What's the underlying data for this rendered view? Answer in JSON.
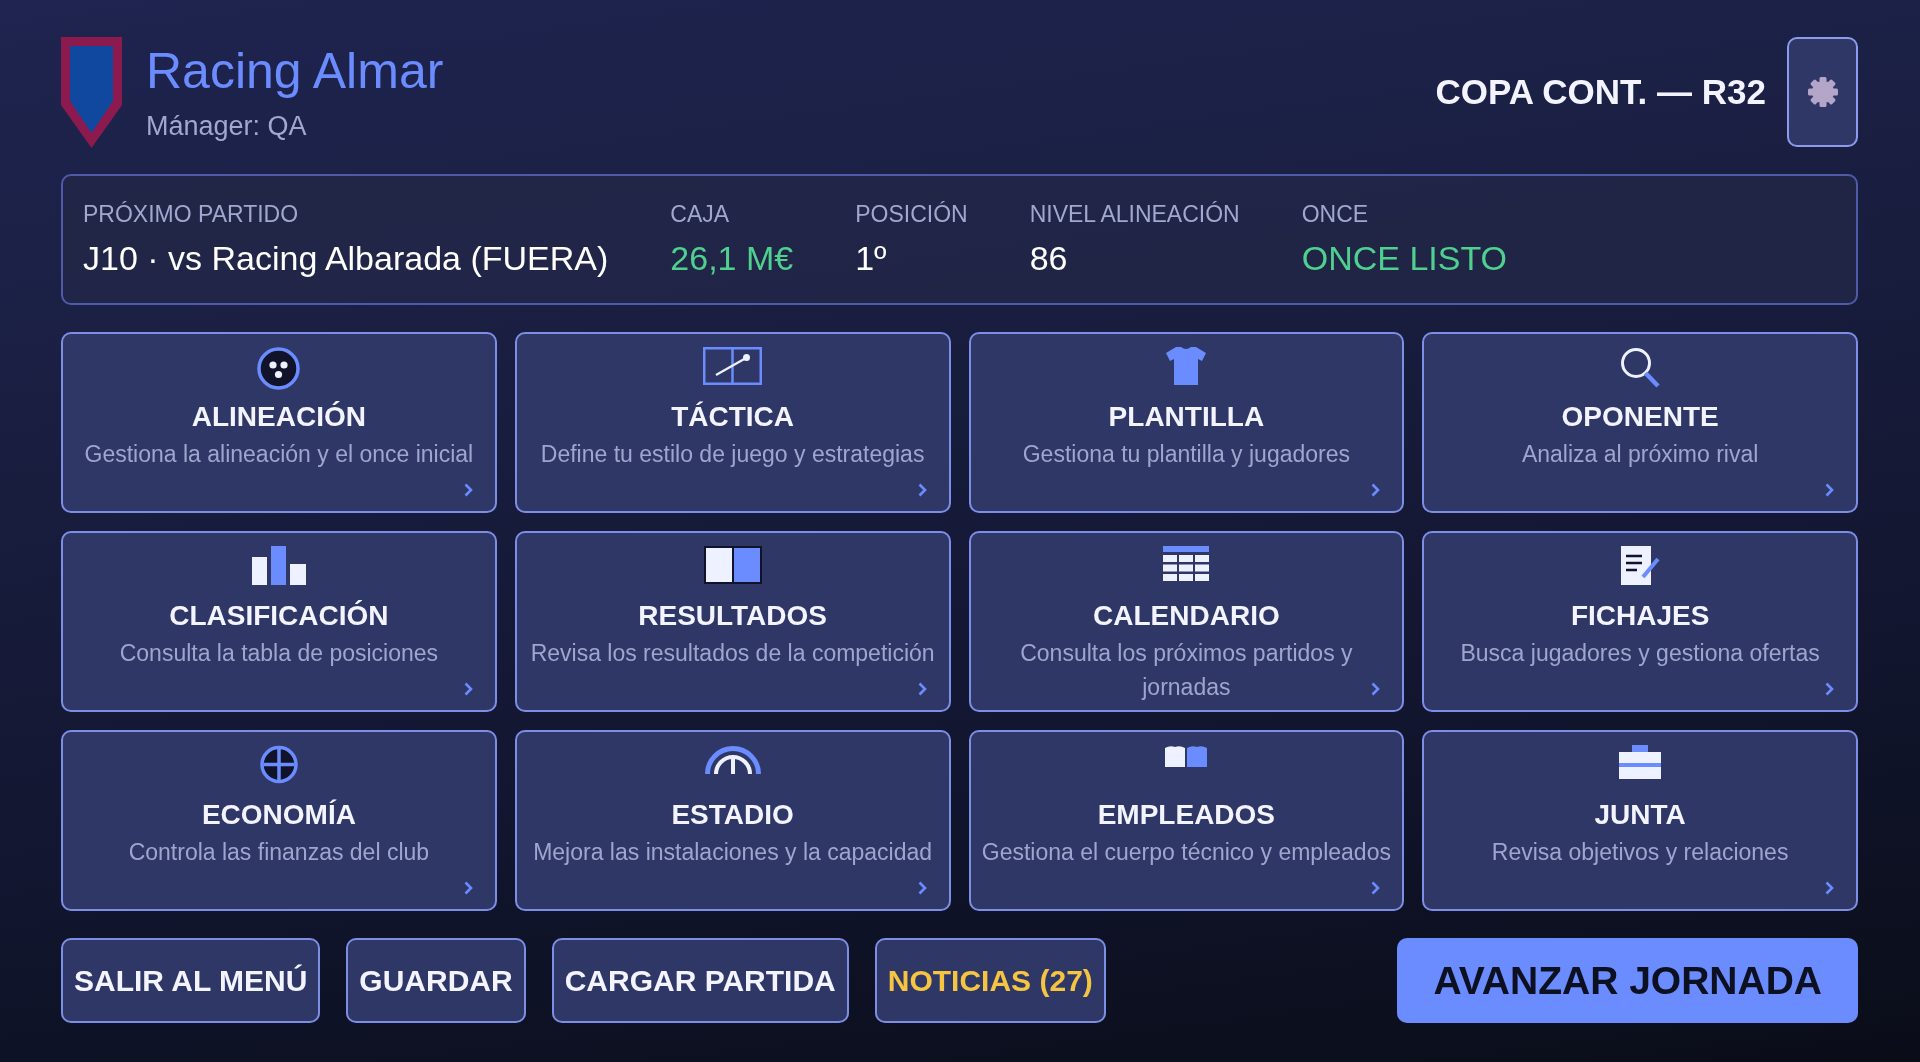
{
  "header": {
    "club_name": "Racing Almar",
    "manager": "Mánager: QA",
    "competition": "COPA CONT. — R32"
  },
  "summary": [
    {
      "label": "PRÓXIMO PARTIDO",
      "value": "J10 · vs Racing Albarada (FUERA)",
      "color": "#ffffff"
    },
    {
      "label": "CAJA",
      "value": "26,1 M€",
      "color": "#4fd08f"
    },
    {
      "label": "POSICIÓN",
      "value": "1º",
      "color": "#ffffff"
    },
    {
      "label": "NIVEL ALINEACIÓN",
      "value": "86",
      "color": "#ffffff"
    },
    {
      "label": "ONCE",
      "value": "ONCE LISTO",
      "color": "#4fd08f"
    }
  ],
  "menu_cards": [
    {
      "title": "ALINEACIÓN",
      "description": "Gestiona la alineación y el once inicial"
    },
    {
      "title": "TÁCTICA",
      "description": "Define tu estilo de juego y estrategias"
    },
    {
      "title": "PLANTILLA",
      "description": "Gestiona tu plantilla y jugadores"
    },
    {
      "title": "OPONENTE",
      "description": "Analiza al próximo rival"
    },
    {
      "title": "CLASIFICACIÓN",
      "description": "Consulta la tabla de posiciones"
    },
    {
      "title": "RESULTADOS",
      "description": "Revisa los resultados de la competición"
    },
    {
      "title": "CALENDARIO",
      "description": "Consulta los próximos partidos y jornadas"
    },
    {
      "title": "FICHAJES",
      "description": "Busca jugadores y gestiona ofertas"
    },
    {
      "title": "ECONOMÍA",
      "description": "Controla las finanzas del club"
    },
    {
      "title": "ESTADIO",
      "description": "Mejora las instalaciones y la capacidad"
    },
    {
      "title": "EMPLEADOS",
      "description": "Gestiona el cuerpo técnico y empleados"
    },
    {
      "title": "JUNTA",
      "description": "Revisa objetivos y relaciones"
    }
  ],
  "actions": [
    {
      "label": "SALIR AL MENÚ",
      "kind": "secondary"
    },
    {
      "label": "GUARDAR",
      "kind": "secondary"
    },
    {
      "label": "CARGAR PARTIDA",
      "kind": "secondary"
    },
    {
      "label": "NOTICIAS (27)",
      "kind": "highlight"
    },
    {
      "label": "AVANZAR JORNADA",
      "kind": "primary"
    }
  ]
}
